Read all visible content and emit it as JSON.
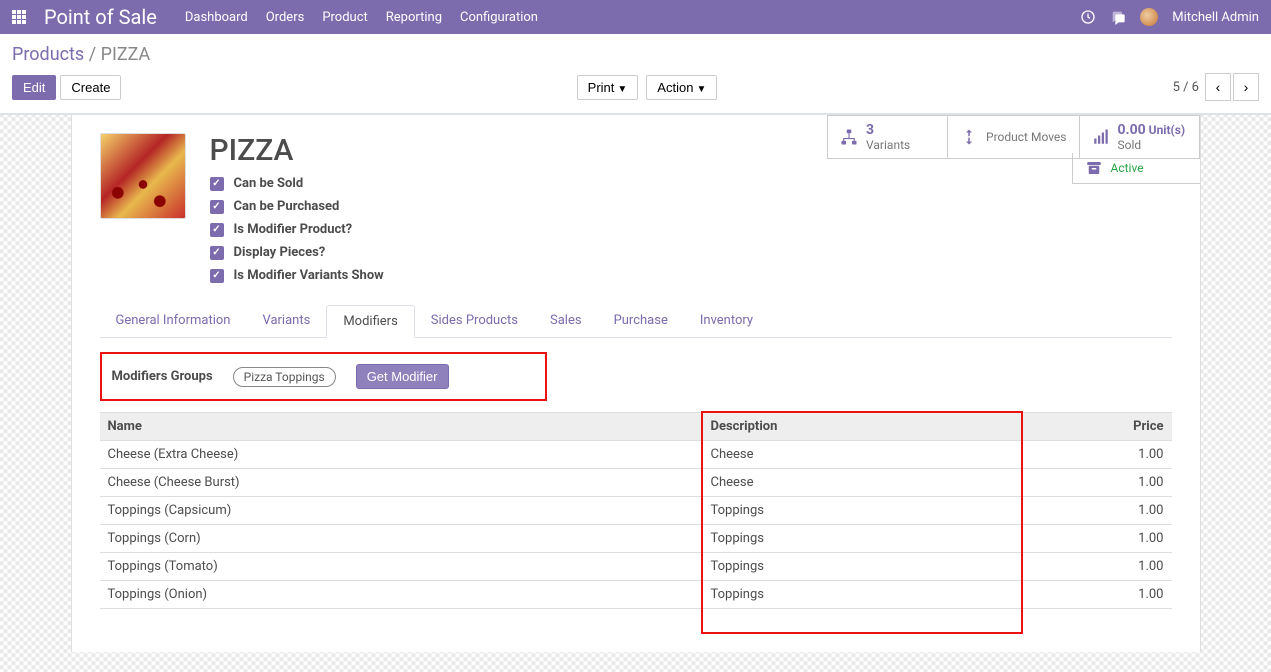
{
  "nav": {
    "brand": "Point of Sale",
    "items": [
      "Dashboard",
      "Orders",
      "Product",
      "Reporting",
      "Configuration"
    ],
    "user": "Mitchell Admin"
  },
  "breadcrumb": {
    "parent": "Products",
    "current": "PIZZA"
  },
  "buttons": {
    "edit": "Edit",
    "create": "Create",
    "print": "Print",
    "action": "Action"
  },
  "pager": {
    "text": "5 / 6"
  },
  "stats": {
    "variants": {
      "count": "3",
      "label": "Variants"
    },
    "moves": {
      "label": "Product Moves"
    },
    "sold": {
      "count": "0.00",
      "unit": "Unit(s)",
      "label": "Sold"
    },
    "active": {
      "label": "Active"
    }
  },
  "product": {
    "name": "PIZZA",
    "checks": [
      "Can be Sold",
      "Can be Purchased",
      "Is Modifier Product?",
      "Display Pieces?",
      "Is Modifier Variants Show"
    ]
  },
  "tabs": [
    "General Information",
    "Variants",
    "Modifiers",
    "Sides Products",
    "Sales",
    "Purchase",
    "Inventory"
  ],
  "activeTabIndex": 2,
  "modifiers": {
    "groups_label": "Modifiers Groups",
    "tag": "Pizza Toppings",
    "button": "Get Modifier",
    "columns": {
      "name": "Name",
      "desc": "Description",
      "price": "Price"
    },
    "rows": [
      {
        "name": "Cheese (Extra Cheese)",
        "desc": "Cheese",
        "price": "1.00"
      },
      {
        "name": "Cheese (Cheese Burst)",
        "desc": "Cheese",
        "price": "1.00"
      },
      {
        "name": "Toppings (Capsicum)",
        "desc": "Toppings",
        "price": "1.00"
      },
      {
        "name": "Toppings (Corn)",
        "desc": "Toppings",
        "price": "1.00"
      },
      {
        "name": "Toppings (Tomato)",
        "desc": "Toppings",
        "price": "1.00"
      },
      {
        "name": "Toppings (Onion)",
        "desc": "Toppings",
        "price": "1.00"
      }
    ]
  }
}
